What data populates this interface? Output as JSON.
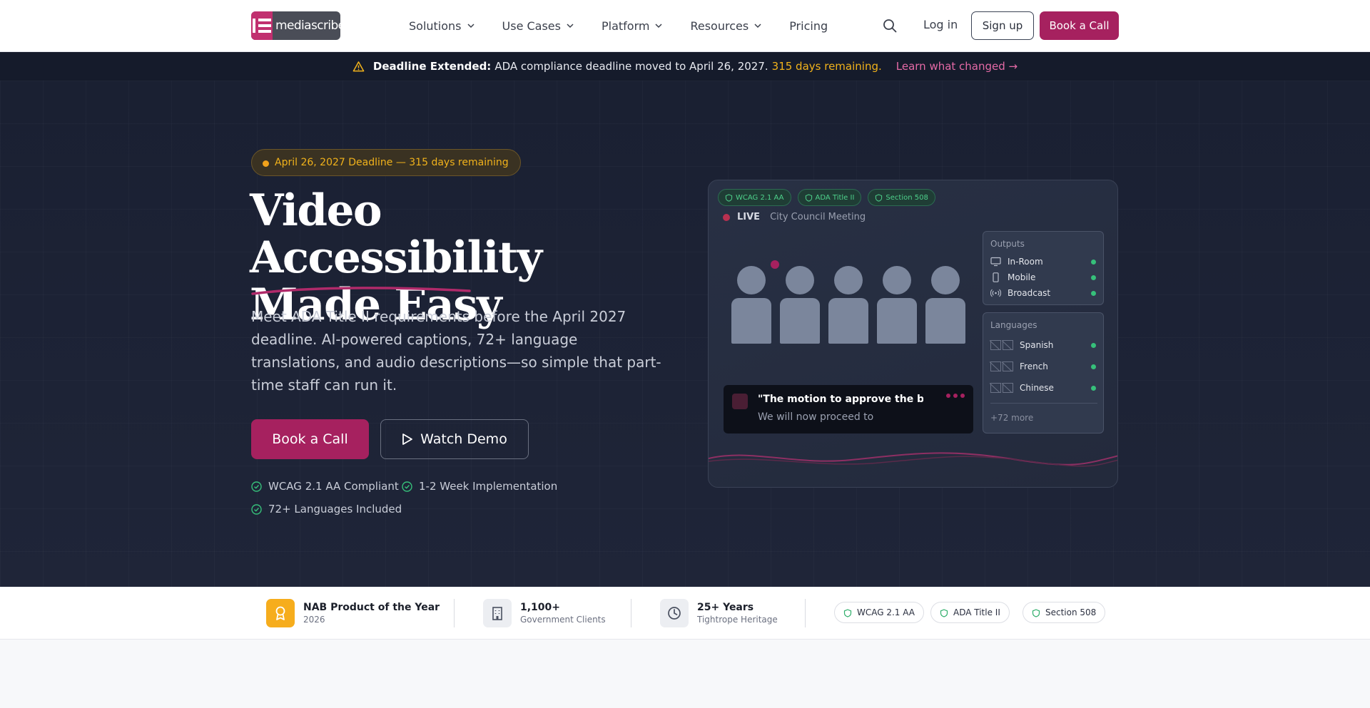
{
  "nav": {
    "logo_text": "mediascribe",
    "menu": [
      {
        "label": "Solutions",
        "dropdown": true
      },
      {
        "label": "Use Cases",
        "dropdown": true
      },
      {
        "label": "Platform",
        "dropdown": true
      },
      {
        "label": "Resources",
        "dropdown": true
      },
      {
        "label": "Pricing",
        "dropdown": false
      }
    ],
    "login": "Log in",
    "signup": "Sign up",
    "cta": "Book a Call"
  },
  "banner": {
    "bold": "Deadline Extended:",
    "text": "ADA compliance deadline moved to April 26, 2027.",
    "days": "315 days remaining.",
    "link": "Learn what changed →"
  },
  "hero": {
    "pill": "April 26, 2027 Deadline — 315 days remaining",
    "title_line1": "Video Accessibility",
    "title_line2": "Made Easy",
    "lead": "Meet ADA Title II requirements before the April 2027 deadline. AI-powered captions, 72+ language translations, and audio descriptions—so simple that part-time staff can run it.",
    "primary_cta": "Book a Call",
    "secondary_cta": "Watch Demo",
    "checks": [
      "WCAG 2.1 AA Compliant",
      "1-2 Week Implementation",
      "72+ Languages Included"
    ]
  },
  "mockup": {
    "tags": [
      "WCAG 2.1 AA",
      "ADA Title II",
      "Section 508"
    ],
    "live_label": "LIVE",
    "meeting": "City Council Meeting",
    "caption_line1": "\"The motion to approve the budget",
    "caption_line2": "We will now proceed to",
    "outputs_title": "Outputs",
    "outputs": [
      "In-Room",
      "Mobile",
      "Broadcast"
    ],
    "languages_title": "Languages",
    "languages": [
      "Spanish",
      "French",
      "Chinese"
    ],
    "more": "+72 more"
  },
  "trust": {
    "items": [
      {
        "value": "NAB Product of the Year",
        "sub": "2026"
      },
      {
        "value": "1,100+",
        "sub": "Government Clients"
      },
      {
        "value": "25+ Years",
        "sub": "Tightrope Heritage"
      }
    ],
    "badges": [
      "WCAG 2.1 AA",
      "ADA Title II",
      "Section 508"
    ]
  },
  "colors": {
    "brand": "#a6215f",
    "hero_bg": "#1d2336",
    "warning": "#f1b21b",
    "success": "#36c07a"
  }
}
